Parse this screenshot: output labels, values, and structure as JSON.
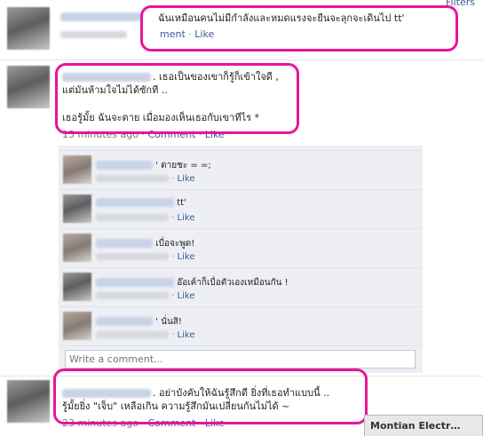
{
  "header": {
    "filters_label": "Filters"
  },
  "posts": [
    {
      "text_lines": [
        "ฉันเหมือนคนไม่มีกำลังและหมดแรงจะยืนจะลุกจะเดินไป tt'"
      ],
      "comment_label": "ment",
      "like_label": "Like"
    },
    {
      "text_lines": [
        ". เธอเป็นของเขาก็รู้ก็เข้าใจดี ,",
        "แต่มันห้ามใจไม่ได้ซักที ..",
        "",
        "เธอรู้มั้ย ฉันจะตาย เมื่อมองเห็นเธอกับเขาทีไร *"
      ],
      "time": "15 minutes ago",
      "comment_label": "Comment",
      "like_label": "Like"
    },
    {
      "text_lines": [
        ". อย่าบังคับให้ฉันรู้สึกดี ยิ่งที่เธอทำแบบนี้ ..",
        "รู้มั้ยยิ่ง \"เจ็บ\" เหลือเกิน ความรู้สึกมันเปลี่ยนกันไม่ได้ ~"
      ],
      "time": "23 minutes ago",
      "comment_label": "Comment",
      "like_label": "Like"
    }
  ],
  "comments": [
    {
      "text": "' ตายชะ = =;",
      "like_label": "Like"
    },
    {
      "text": "tt'",
      "like_label": "Like"
    },
    {
      "text": "เบื่อจะพูด!",
      "like_label": "Like"
    },
    {
      "text": "อ๊อเค้าก็เบื่อตัวเองเหมือนกัน !",
      "like_label": "Like"
    },
    {
      "text": "' นั่นสิ!",
      "like_label": "Like"
    }
  ],
  "comment_input": {
    "placeholder": "Write a comment..."
  },
  "chat_tab": {
    "label": "Montian Electr…"
  },
  "colors": {
    "highlight": "#e8159a",
    "link": "#3b5998",
    "comments_bg": "#edeff4"
  }
}
